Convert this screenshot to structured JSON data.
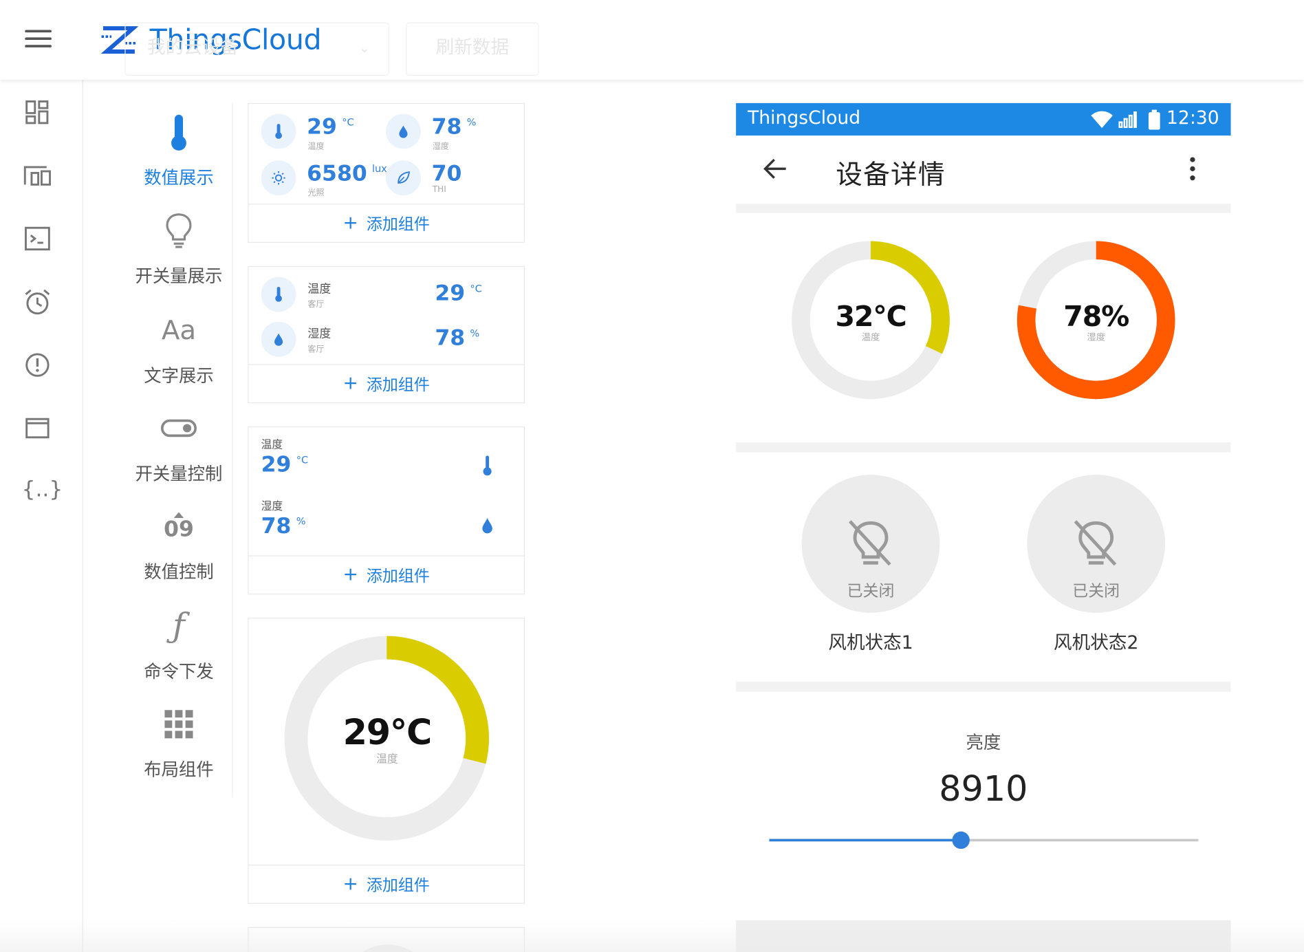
{
  "brand": {
    "name": "ThingsCloud",
    "accent": "#1677d9"
  },
  "header": {
    "device_select_placeholder": "我的云设备",
    "refresh_label": "刷新数据"
  },
  "palette": {
    "active_color": "#1d7fe0",
    "items": [
      {
        "label": "数值展示",
        "icon": "thermometer-icon",
        "active": true
      },
      {
        "label": "开关量展示",
        "icon": "bulb-icon"
      },
      {
        "label": "文字展示",
        "icon": "text-aa-icon",
        "glyph": "Aa"
      },
      {
        "label": "开关量控制",
        "icon": "toggle-icon"
      },
      {
        "label": "数值控制",
        "icon": "number-stepper-icon",
        "glyph": "09"
      },
      {
        "label": "命令下发",
        "icon": "function-icon",
        "glyph": "ƒ"
      },
      {
        "label": "布局组件",
        "icon": "grid-icon"
      }
    ]
  },
  "cards": {
    "add_label": "添加组件",
    "card1": {
      "items": [
        {
          "value": "29",
          "unit": "°C",
          "sub": "温度",
          "icon": "thermometer-icon"
        },
        {
          "value": "78",
          "unit": "%",
          "sub": "湿度",
          "icon": "water-drop-icon"
        },
        {
          "value": "6580",
          "unit": "lux",
          "sub": "光照",
          "icon": "sun-icon"
        },
        {
          "value": "70",
          "unit": "",
          "sub": "THI",
          "icon": "leaf-icon"
        }
      ]
    },
    "card2": {
      "rows": [
        {
          "label": "温度",
          "sub": "客厅",
          "value": "29",
          "unit": "°C",
          "icon": "thermometer-icon"
        },
        {
          "label": "湿度",
          "sub": "客厅",
          "value": "78",
          "unit": "%",
          "icon": "water-drop-icon"
        }
      ]
    },
    "card3": {
      "rows": [
        {
          "label": "温度",
          "value": "29",
          "unit": "°C",
          "icon": "thermometer-icon"
        },
        {
          "label": "湿度",
          "value": "78",
          "unit": "%",
          "icon": "water-drop-icon"
        }
      ]
    },
    "card4": {
      "gauge_value": "29°C",
      "gauge_label": "温度",
      "fraction": 0.29,
      "color": "#d9cc00"
    }
  },
  "phone": {
    "status_title": "ThingsCloud",
    "time": "12:30",
    "status_color": "#1e88e5",
    "page_title": "设备详情",
    "gauges": [
      {
        "value": "32°C",
        "label": "温度",
        "fraction": 0.32,
        "color": "#d9cc00"
      },
      {
        "value": "78%",
        "label": "湿度",
        "fraction": 0.78,
        "color": "#ff5a00"
      }
    ],
    "fans": [
      {
        "state": "已关闭",
        "name": "风机状态1"
      },
      {
        "state": "已关闭",
        "name": "风机状态2"
      }
    ],
    "brightness": {
      "label": "亮度",
      "value": "8910",
      "fraction": 0.445
    }
  }
}
